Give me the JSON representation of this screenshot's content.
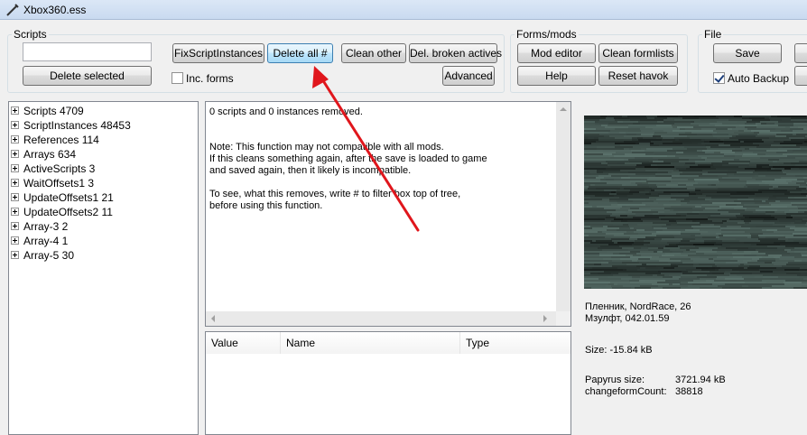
{
  "window": {
    "title": "Xbox360.ess"
  },
  "scripts_group": {
    "legend": "Scripts",
    "filter_value": "",
    "delete_selected": "Delete selected",
    "fix_script_instances": "FixScriptInstances",
    "delete_all": "Delete all #",
    "clean_other": "Clean other",
    "del_broken_actives": "Del. broken actives",
    "advanced": "Advanced",
    "inc_forms_label": "Inc. forms",
    "inc_forms_checked": false
  },
  "forms_group": {
    "legend": "Forms/mods",
    "mod_editor": "Mod editor",
    "clean_formlists": "Clean formlists",
    "help": "Help",
    "reset_havok": "Reset havok"
  },
  "file_group": {
    "legend": "File",
    "save": "Save",
    "auto_backup_label": "Auto Backup",
    "auto_backup_checked": true
  },
  "tree": {
    "items": [
      {
        "label": "Scripts 4709"
      },
      {
        "label": "ScriptInstances 48453"
      },
      {
        "label": "References 114"
      },
      {
        "label": "Arrays 634"
      },
      {
        "label": "ActiveScripts 3"
      },
      {
        "label": "WaitOffsets1 3"
      },
      {
        "label": "UpdateOffsets1 21"
      },
      {
        "label": "UpdateOffsets2 11"
      },
      {
        "label": "Array-3 2"
      },
      {
        "label": "Array-4 1"
      },
      {
        "label": "Array-5 30"
      }
    ]
  },
  "message": {
    "text": "0 scripts and 0 instances removed.\n\n\nNote: This function may not compatible with all mods.\nIf this cleans something again, after the save is loaded to game\nand saved again, then it likely is incompatible.\n\nTo see, what this removes, write # to filter box top of tree,\nbefore using this function."
  },
  "table": {
    "columns": [
      {
        "label": "Value"
      },
      {
        "label": "Name"
      },
      {
        "label": "Type"
      }
    ]
  },
  "save_info": {
    "line1": "Пленник, NordRace, 26",
    "line2": "Мзулфт, 042.01.59",
    "size": "Size: -15.84 kB",
    "papyrus_label": "Papyrus size:",
    "papyrus_value": "3721.94 kB",
    "changeform_label": "changeformCount:",
    "changeform_value": "38818"
  },
  "colors": {
    "annotation_arrow": "#e0161c",
    "hot_button": "#bee6fd"
  }
}
